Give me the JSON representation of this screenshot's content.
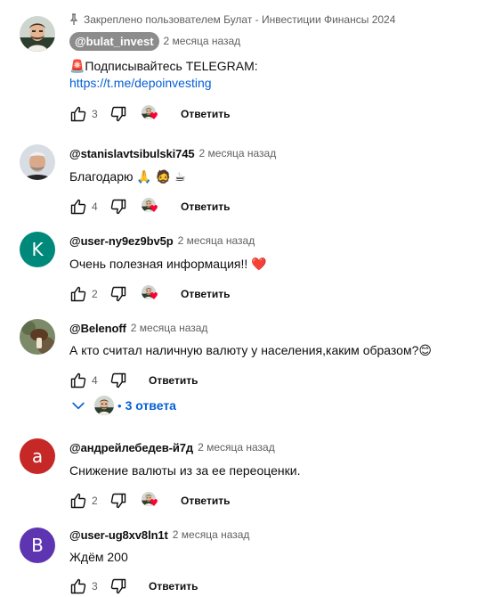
{
  "colors": {
    "link": "#065fd4",
    "meta": "#606060",
    "pill_bg": "#8c8c8c",
    "heart": "#ff0033",
    "avatar_k": "#00897b",
    "avatar_a": "#c62828",
    "avatar_b": "#5e35b1"
  },
  "icons": {
    "like": "thumbs-up-icon",
    "dislike": "thumbs-down-icon",
    "pin": "pin-icon",
    "chevron": "chevron-down-icon",
    "heart": "heart-icon"
  },
  "reply_label": "Ответить",
  "comments": [
    {
      "pinned_text": "Закреплено пользователем Булат - Инвестиции Финансы 2024",
      "author": "@bulat_invest",
      "date": "2 месяца назад",
      "text_line1": "🚨Подписывайтесь TELEGRAM:",
      "link": "https://t.me/depoinvesting",
      "likes": "3"
    },
    {
      "author": "@stanislavtsibulski745",
      "date": "2 месяца назад",
      "text": "Благодарю 🙏 🧔 ☕",
      "likes": "4"
    },
    {
      "avatar_letter": "K",
      "author": "@user-ny9ez9bv5p",
      "date": "2 месяца назад",
      "text": "Очень полезная информация!! ❤️",
      "likes": "2"
    },
    {
      "author": "@Belenoff",
      "date": "2 месяца назад",
      "text": "А кто считал наличную валюту у населения,каким образом?😊",
      "likes": "4",
      "replies": "3 ответа"
    },
    {
      "avatar_letter": "a",
      "author": "@андрейлебедев-й7д",
      "date": "2 месяца назад",
      "text": "Снижение валюты из за ее переоценки.",
      "likes": "2"
    },
    {
      "avatar_letter": "B",
      "author": "@user-ug8xv8ln1t",
      "date": "2 месяца назад",
      "text": "Ждём 200",
      "likes": "3"
    }
  ]
}
